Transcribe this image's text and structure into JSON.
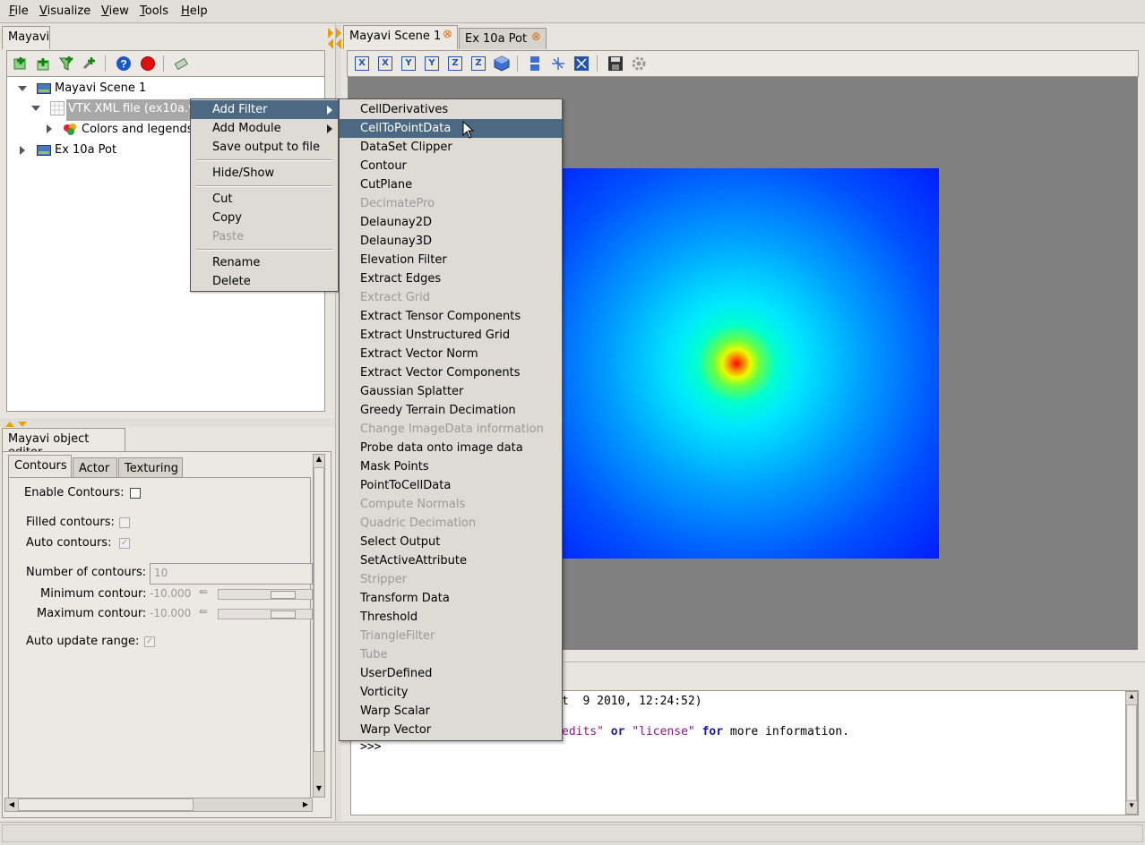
{
  "menubar": {
    "items": [
      "File",
      "Visualize",
      "View",
      "Tools",
      "Help"
    ]
  },
  "left_panel": {
    "tab_label": "Mayavi",
    "tree": [
      {
        "label": "Mayavi Scene 1"
      },
      {
        "label": "VTK XML file (ex10a.vtu)"
      },
      {
        "label": "Colors and legends"
      },
      {
        "label": "Ex 10a Pot"
      }
    ]
  },
  "editor": {
    "title": "Mayavi object editor",
    "tabs": [
      "Contours",
      "Actor",
      "Texturing"
    ],
    "enable_contours_label": "Enable Contours:",
    "filled_contours_label": "Filled contours:",
    "auto_contours_label": "Auto contours:",
    "number_contours_label": "Number of contours:",
    "number_contours_value": "10",
    "min_contour_label": "Minimum contour:",
    "min_contour_value": "-10.000",
    "max_contour_label": "Maximum contour:",
    "max_contour_value": "-10.000",
    "auto_update_label": "Auto update range:"
  },
  "scene_tabs": [
    {
      "label": "Mayavi Scene 1",
      "close": "⊗"
    },
    {
      "label": "Ex 10a Pot",
      "close": "⊗"
    }
  ],
  "scene_toolbar": {
    "buttons": [
      "X",
      "X",
      "Y",
      "Y",
      "Z",
      "Z"
    ]
  },
  "context_menu": {
    "items": [
      "Add Filter",
      "Add Module",
      "Save output to file",
      "Hide/Show",
      "Cut",
      "Copy",
      "Paste",
      "Rename",
      "Delete"
    ]
  },
  "submenu": {
    "items": [
      {
        "label": "CellDerivatives",
        "enabled": true
      },
      {
        "label": "CellToPointData",
        "enabled": true
      },
      {
        "label": "DataSet Clipper",
        "enabled": true
      },
      {
        "label": "Contour",
        "enabled": true
      },
      {
        "label": "CutPlane",
        "enabled": true
      },
      {
        "label": "DecimatePro",
        "enabled": false
      },
      {
        "label": "Delaunay2D",
        "enabled": true
      },
      {
        "label": "Delaunay3D",
        "enabled": true
      },
      {
        "label": "Elevation Filter",
        "enabled": true
      },
      {
        "label": "Extract Edges",
        "enabled": true
      },
      {
        "label": "Extract Grid",
        "enabled": false
      },
      {
        "label": "Extract Tensor Components",
        "enabled": true
      },
      {
        "label": "Extract Unstructured Grid",
        "enabled": true
      },
      {
        "label": "Extract Vector Norm",
        "enabled": true
      },
      {
        "label": "Extract Vector Components",
        "enabled": true
      },
      {
        "label": "Gaussian Splatter",
        "enabled": true
      },
      {
        "label": "Greedy Terrain Decimation",
        "enabled": true
      },
      {
        "label": "Change ImageData information",
        "enabled": false
      },
      {
        "label": "Probe data onto image data",
        "enabled": true
      },
      {
        "label": "Mask Points",
        "enabled": true
      },
      {
        "label": "PointToCellData",
        "enabled": true
      },
      {
        "label": "Compute Normals",
        "enabled": false
      },
      {
        "label": "Quadric Decimation",
        "enabled": false
      },
      {
        "label": "Select Output",
        "enabled": true
      },
      {
        "label": "SetActiveAttribute",
        "enabled": true
      },
      {
        "label": "Stripper",
        "enabled": false
      },
      {
        "label": "Transform Data",
        "enabled": true
      },
      {
        "label": "Threshold",
        "enabled": true
      },
      {
        "label": "TriangleFilter",
        "enabled": false
      },
      {
        "label": "Tube",
        "enabled": false
      },
      {
        "label": "UserDefined",
        "enabled": true
      },
      {
        "label": "Vorticity",
        "enabled": true
      },
      {
        "label": "Warp Scalar",
        "enabled": true
      },
      {
        "label": "Warp Vector",
        "enabled": true
      }
    ]
  },
  "shell": {
    "line1_tail": "t  9 2010, 12:24:52)",
    "line2_a": "edits\"",
    "line2_or": "or",
    "line2_license": "\"license\"",
    "line2_for": "for",
    "line2_tail": "more information.",
    "prompt": ">>>"
  },
  "colors": {
    "highlight": "#4b6983",
    "viewport_bg": "#808080"
  }
}
